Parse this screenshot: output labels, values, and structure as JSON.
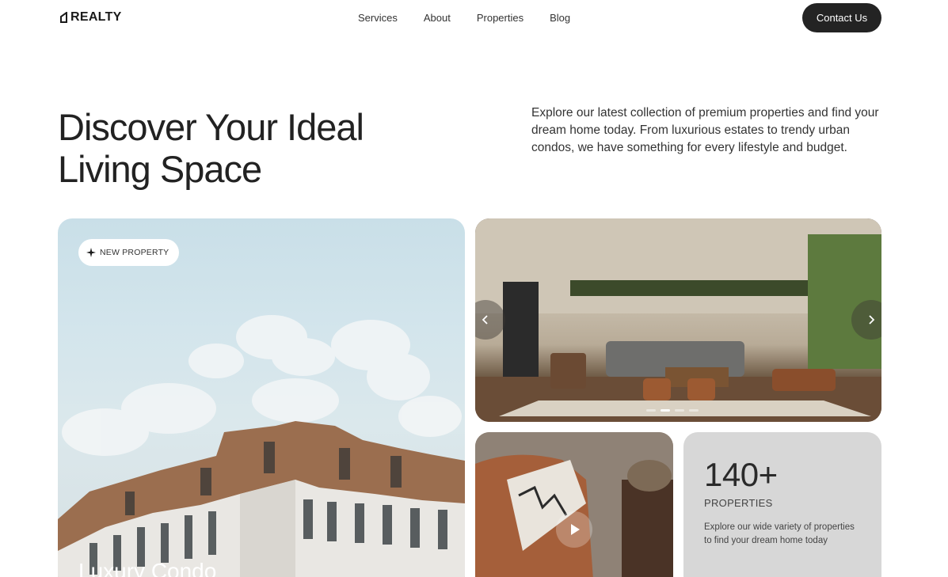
{
  "header": {
    "logo_text": "REALTY",
    "nav": [
      {
        "label": "Services"
      },
      {
        "label": "About"
      },
      {
        "label": "Properties"
      },
      {
        "label": "Blog"
      }
    ],
    "contact_label": "Contact Us"
  },
  "hero": {
    "title": "Discover Your Ideal Living Space",
    "description": "Explore our latest collection of premium properties and find your dream home today. From luxurious estates to trendy urban condos, we have something for every lifestyle and budget."
  },
  "featured": {
    "badge": "NEW PROPERTY",
    "badge_icon": "sparkle-icon",
    "caption": "Luxury Condo"
  },
  "gallery": {
    "prev_icon": "chevron-left-icon",
    "next_icon": "chevron-right-icon",
    "slide_count": 4,
    "active_slide": 2
  },
  "video": {
    "play_icon": "play-icon"
  },
  "stats": {
    "number": "140+",
    "label": "PROPERTIES",
    "description": "Explore our wide variety of properties to find your dream home today"
  },
  "colors": {
    "accent_dark": "#232323",
    "stats_bg": "#d7d7d7",
    "text": "#1f1f1f"
  }
}
